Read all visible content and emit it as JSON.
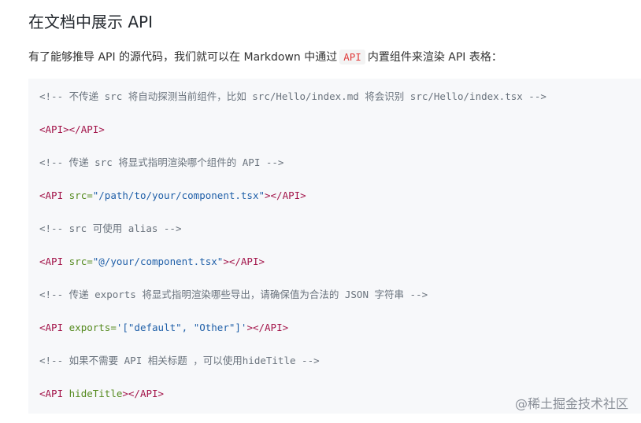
{
  "heading": "在文档中展示 API",
  "intro": {
    "before": "有了能够推导 API 的源代码，我们就可以在 Markdown 中通过",
    "code": "API",
    "after": "内置组件来渲染 API 表格："
  },
  "code": {
    "line1": "<!-- 不传递 src 将自动探测当前组件，比如 src/Hello/index.md 将会识别 src/Hello/index.tsx -->",
    "line2_open": "<API>",
    "line2_close": "</API>",
    "line3": "<!-- 传递 src 将显式指明渲染哪个组件的 API -->",
    "line4_tag_open": "<API",
    "line4_attr": "src=",
    "line4_value": "\"/path/to/your/component.tsx\"",
    "line4_end": "></API>",
    "line5": "<!-- src 可使用 alias -->",
    "line6_tag_open": "<API",
    "line6_attr": "src=",
    "line6_value": "\"@/your/component.tsx\"",
    "line6_end": "></API>",
    "line7": "<!-- 传递 exports 将显式指明渲染哪些导出，请确保值为合法的 JSON 字符串 -->",
    "line8_tag_open": "<API",
    "line8_attr": "exports=",
    "line8_value": "'[\"default\", \"Other\"]'",
    "line8_end": "></API>",
    "line9": "<!-- 如果不需要 API 相关标题 ，可以使用hideTitle -->",
    "line10_tag_open": "<API",
    "line10_attr": "hideTitle",
    "line10_end": "></API>"
  },
  "watermark": "@稀土掘金技术社区"
}
